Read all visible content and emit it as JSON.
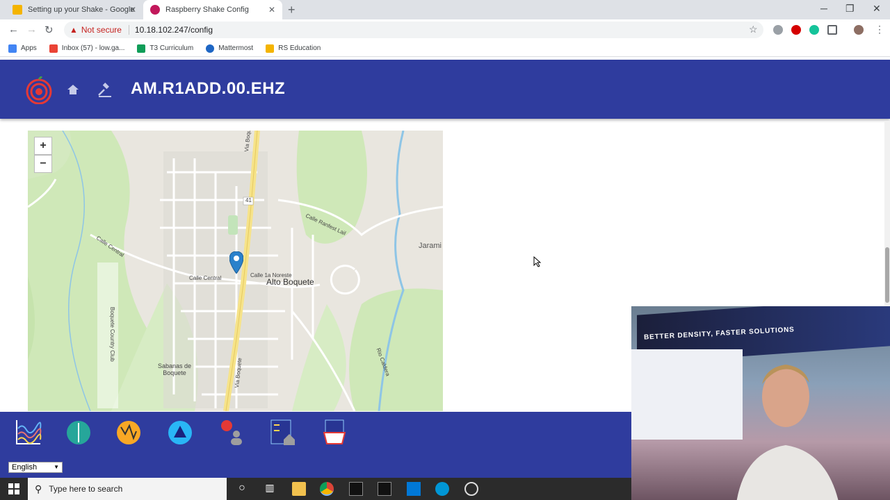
{
  "browser": {
    "tabs": [
      {
        "label": "Setting up your Shake - Google",
        "color": "#f4b400"
      },
      {
        "label": "Raspberry Shake Config",
        "color": "#c2185b"
      }
    ],
    "security_label": "Not secure",
    "url": "10.18.102.247/config"
  },
  "bookmarks": [
    {
      "label": "Apps",
      "icon": "apps-grid-icon"
    },
    {
      "label": "Inbox (57) - low.ga...",
      "icon": "gmail-icon"
    },
    {
      "label": "T3 Curriculum",
      "icon": "drive-icon"
    },
    {
      "label": "Mattermost",
      "icon": "mattermost-icon"
    },
    {
      "label": "RS Education",
      "icon": "drive-icon"
    }
  ],
  "header": {
    "station_code": "AM.R1ADD.00.EHZ",
    "accent": "#2f3c9e"
  },
  "map": {
    "zoom_in": "+",
    "zoom_out": "−",
    "labels": {
      "main": "Alto Boquete",
      "road1": "Via Boquete",
      "road2": "Via Boquete",
      "central1": "Calle Central",
      "central2": "Calle Central",
      "noreste": "Calle 1a Noreste",
      "ranfest": "Calle Ranfest Lail",
      "jarami": "Jarami",
      "sabanas": "Sabanas de Boquete",
      "club": "Boquete Country Club",
      "caldera": "Rio Caldera",
      "route": "41"
    }
  },
  "footer": {
    "language": "English"
  },
  "webcam": {
    "banner": "BETTER DENSITY, FASTER SOLUTIONS"
  },
  "taskbar": {
    "search_placeholder": "Type here to search"
  }
}
